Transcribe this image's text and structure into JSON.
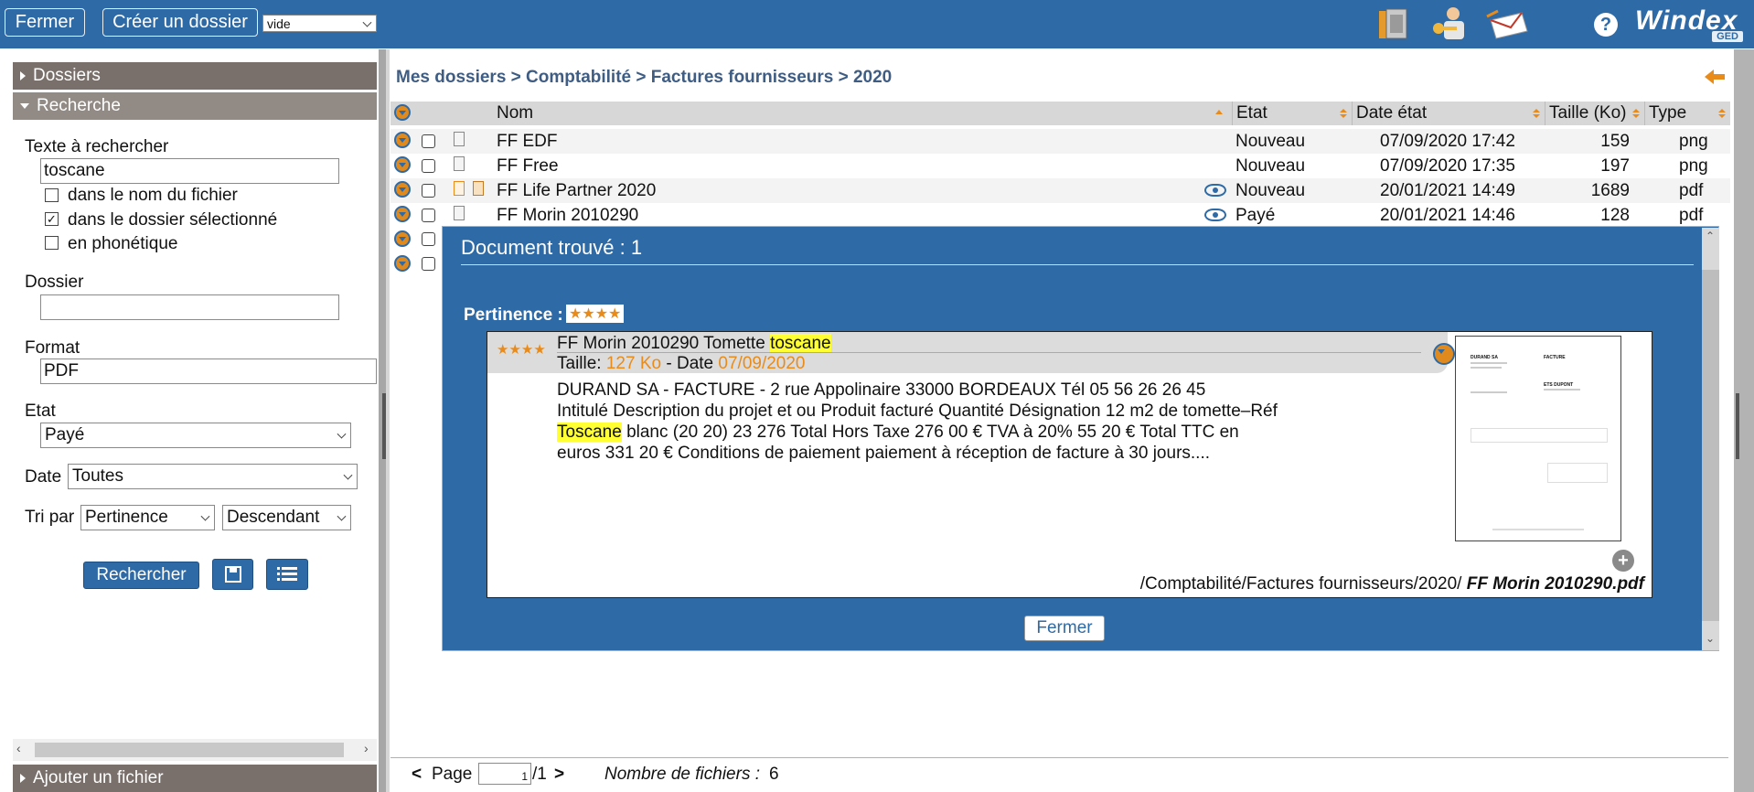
{
  "toolbar": {
    "close_label": "Fermer",
    "create_folder_label": "Créer un dossier",
    "view_select": "vide",
    "brand": "Windex",
    "brand_sub": "GED",
    "help": "?"
  },
  "sidebar": {
    "folders_label": "Dossiers",
    "search_label": "Recherche",
    "text_label": "Texte à rechercher",
    "text_value": "toscane",
    "opt_filename": "dans le nom du fichier",
    "opt_selected_folder": "dans le dossier sélectionné",
    "opt_phonetic": "en phonétique",
    "folder_label": "Dossier",
    "folder_value": "",
    "format_label": "Format",
    "format_value": "PDF",
    "state_label": "Etat",
    "state_value": "Payé",
    "date_label": "Date",
    "date_value": "Toutes",
    "sort_label": "Tri par",
    "sort_value": "Pertinence",
    "order_value": "Descendant",
    "search_button": "Rechercher",
    "add_file_label": "Ajouter un fichier"
  },
  "breadcrumb": "Mes dossiers > Comptabilité > Factures fournisseurs > 2020",
  "grid": {
    "columns": [
      "Nom",
      "Etat",
      "Date état",
      "Taille (Ko)",
      "Type"
    ],
    "rows": [
      {
        "name": "FF EDF",
        "state": "Nouveau",
        "date": "07/09/2020 17:42",
        "size": "159",
        "type": "png"
      },
      {
        "name": "FF Free",
        "state": "Nouveau",
        "date": "07/09/2020 17:35",
        "size": "197",
        "type": "png"
      },
      {
        "name": "FF Life Partner 2020",
        "state": "Nouveau",
        "date": "20/01/2021 14:49",
        "size": "1689",
        "type": "pdf"
      },
      {
        "name": "FF Morin 2010290",
        "state": "Payé",
        "date": "20/01/2021 14:46",
        "size": "128",
        "type": "pdf"
      }
    ]
  },
  "popup": {
    "title": "Document trouvé : 1",
    "relevance_label": "Pertinence :",
    "stars": "★★★★",
    "doc_title": "FF Morin 2010290 Tomette",
    "doc_highlight": "toscane",
    "size_label": "Taille:",
    "size_value": "127 Ko",
    "date_label": "- Date",
    "date_value": "07/09/2020",
    "excerpt_line1": "DURAND SA - FACTURE - 2 rue Appolinaire 33000 BORDEAUX Tél 05 56 26 26 45",
    "excerpt_pre": "Intitulé Description du projet et ou Produit facturé Quantité Désignation 12 m2 de tomette–Réf",
    "excerpt_highlight": "Toscane",
    "excerpt_post": "blanc (20 20) 23 276 Total Hors Taxe 276 00 € TVA à 20% 55 20 € Total TTC en euros 331 20 € Conditions de paiement paiement à réception de facture à 30 jours....",
    "path_prefix": "/Comptabilité/Factures fournisseurs/2020/",
    "path_file": "FF Morin 2010290.pdf",
    "close_label": "Fermer",
    "thumb_company": "DURAND SA",
    "thumb_doc": "FACTURE",
    "thumb_client": "ETS DUPONT"
  },
  "footer": {
    "prev": "<",
    "page_label": "Page",
    "page_value": "1",
    "page_total": "/1",
    "next": ">",
    "count_label": "Nombre de fichiers :",
    "count_value": "6"
  },
  "colors": {
    "primary": "#2e6aa6",
    "accent": "#e88b1a",
    "section": "#7a706b"
  }
}
